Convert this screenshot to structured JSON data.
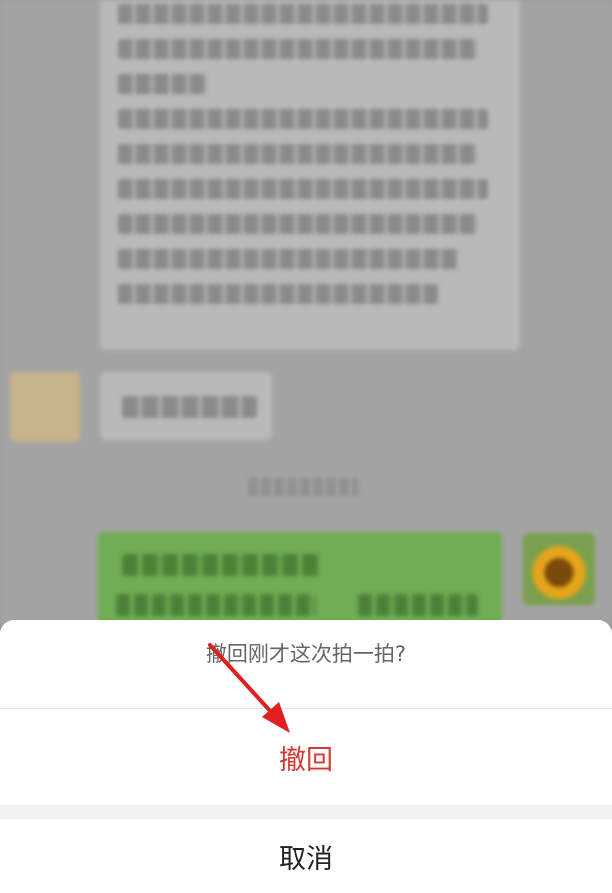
{
  "sheet": {
    "title": "撤回刚才这次拍一拍?",
    "confirm_label": "撤回",
    "cancel_label": "取消"
  },
  "colors": {
    "confirm": "#d23a33",
    "annotation_arrow": "#e02020",
    "sent_bubble": "#6fae53"
  }
}
